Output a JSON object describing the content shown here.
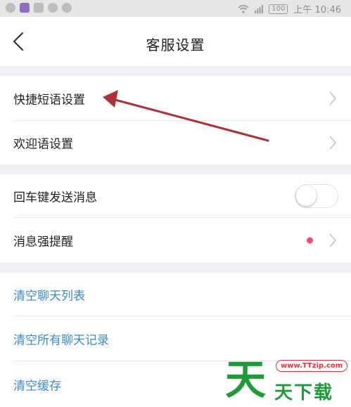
{
  "status_bar": {
    "battery": "100",
    "time": "上午 10:46"
  },
  "header": {
    "title": "客服设置"
  },
  "section1": {
    "items": [
      {
        "label": "快捷短语设置"
      },
      {
        "label": "欢迎语设置"
      }
    ]
  },
  "section2": {
    "enter_send": {
      "label": "回车键发送消息",
      "toggle_on": false
    },
    "strong_reminder": {
      "label": "消息强提醒"
    }
  },
  "section3": {
    "items": [
      {
        "label": "清空聊天列表"
      },
      {
        "label": "清空所有聊天记录"
      },
      {
        "label": "清空缓存"
      }
    ]
  },
  "watermark": {
    "url": "www.TTzip.com",
    "big_char": "天",
    "text": "天下载"
  },
  "colors": {
    "accent_blue": "#3c89c9",
    "annotation_red": "#b0303a",
    "badge_dot": "#f0506e"
  }
}
